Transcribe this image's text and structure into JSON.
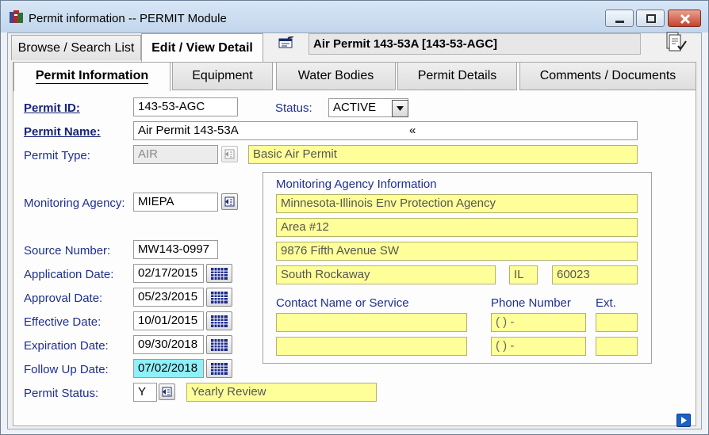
{
  "window": {
    "title": "Permit information -- PERMIT Module",
    "min_icon": "minimize-icon",
    "max_icon": "maximize-icon",
    "close_icon": "close-icon"
  },
  "top_tabs": [
    {
      "label": "Browse / Search List",
      "active": false
    },
    {
      "label": "Edit / View Detail",
      "active": true
    }
  ],
  "header": {
    "title": "Air Permit 143-53A [143-53-AGC]",
    "edit_icon": "edit-record-icon",
    "report_icon": "report-check-icon"
  },
  "sub_tabs": [
    {
      "label": "Permit Information",
      "active": true
    },
    {
      "label": "Equipment",
      "active": false
    },
    {
      "label": "Water Bodies",
      "active": false
    },
    {
      "label": "Permit Details",
      "active": false
    },
    {
      "label": "Comments / Documents",
      "active": false
    }
  ],
  "form": {
    "permit_id": {
      "label": "Permit ID:",
      "value": "143-53-AGC"
    },
    "status": {
      "label": "Status:",
      "value": "ACTIVE"
    },
    "permit_name": {
      "label": "Permit Name:",
      "value": "Air Permit 143-53A",
      "marker": "«"
    },
    "permit_type": {
      "label": "Permit Type:",
      "code": "AIR",
      "description": "Basic Air Permit"
    },
    "monitoring_agency": {
      "label": "Monitoring Agency:",
      "code": "MIEPA"
    },
    "source_number": {
      "label": "Source Number:",
      "value": "MW143-0997"
    },
    "application_date": {
      "label": "Application Date:",
      "value": "02/17/2015"
    },
    "approval_date": {
      "label": "Approval Date:",
      "value": "05/23/2015"
    },
    "effective_date": {
      "label": "Effective Date:",
      "value": "10/01/2015"
    },
    "expiration_date": {
      "label": "Expiration Date:",
      "value": "09/30/2018"
    },
    "follow_up_date": {
      "label": "Follow Up Date:",
      "value": "07/02/2018"
    },
    "permit_status": {
      "label": "Permit Status:",
      "code": "Y",
      "description": "Yearly Review"
    }
  },
  "agency_info": {
    "heading": "Monitoring Agency Information",
    "name": "Minnesota-Illinois Env Protection Agency",
    "address1": "Area #12",
    "address2": "9876 Fifth Avenue SW",
    "city": "South Rockaway",
    "state": "IL",
    "zip": "60023",
    "contact_label": "Contact Name or Service",
    "phone_label": "Phone Number",
    "ext_label": "Ext.",
    "contacts": [
      {
        "name": "",
        "phone": "(   )    -",
        "ext": ""
      },
      {
        "name": "",
        "phone": "(   )    -",
        "ext": ""
      }
    ]
  }
}
